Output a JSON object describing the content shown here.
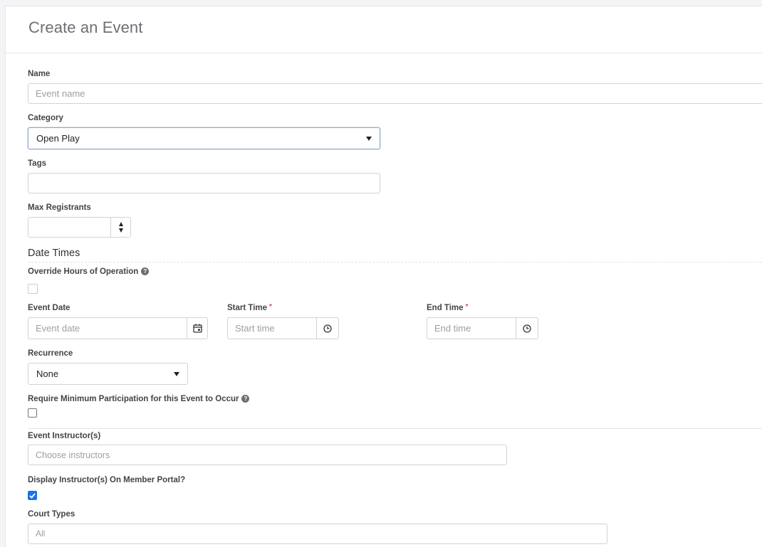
{
  "page": {
    "title": "Create an Event"
  },
  "form": {
    "name": {
      "label": "Name",
      "placeholder": "Event name"
    },
    "category": {
      "label": "Category",
      "value": "Open Play"
    },
    "tags": {
      "label": "Tags"
    },
    "max_registrants": {
      "label": "Max Registrants"
    },
    "date_times": {
      "section_title": "Date Times",
      "override": {
        "label": "Override Hours of Operation",
        "help": "?"
      },
      "event_date": {
        "label": "Event Date",
        "placeholder": "Event date"
      },
      "start_time": {
        "label": "Start Time",
        "required": "*",
        "placeholder": "Start time"
      },
      "end_time": {
        "label": "End Time",
        "required": "*",
        "placeholder": "End time"
      },
      "recurrence": {
        "label": "Recurrence",
        "value": "None"
      }
    },
    "min_participation": {
      "label": "Require Minimum Participation for this Event to Occur",
      "help": "?"
    },
    "instructors": {
      "label": "Event Instructor(s)",
      "placeholder": "Choose instructors"
    },
    "display_instructors": {
      "label": "Display Instructor(s) On Member Portal?",
      "checked": true
    },
    "court_types": {
      "label": "Court Types",
      "value": "All"
    }
  },
  "colors": {
    "accent": "#1a73e8",
    "required": "#d9534f",
    "border": "#cfd3d8"
  }
}
